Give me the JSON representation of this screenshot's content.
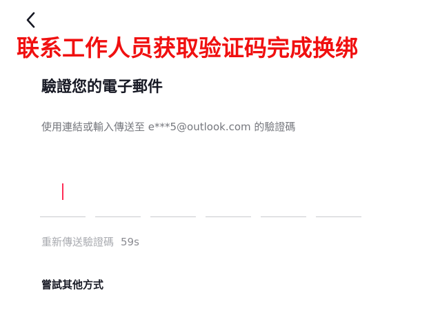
{
  "header": {
    "back_icon": "chevron-left-icon"
  },
  "banner": {
    "text": "联系工作人员获取验证码完成换绑",
    "color": "#f01010"
  },
  "title": "驗證您的電子郵件",
  "instructions": "使用連結或輸入傳送至 e***5@outlook.com 的驗證碼",
  "code_input": {
    "length": 6,
    "values": [
      "",
      "",
      "",
      "",
      "",
      ""
    ],
    "active_index": 0,
    "caret_color": "#fe2c55"
  },
  "resend": {
    "label": "重新傳送驗證碼",
    "countdown": "59s"
  },
  "other_method_label": "嘗試其他方式"
}
